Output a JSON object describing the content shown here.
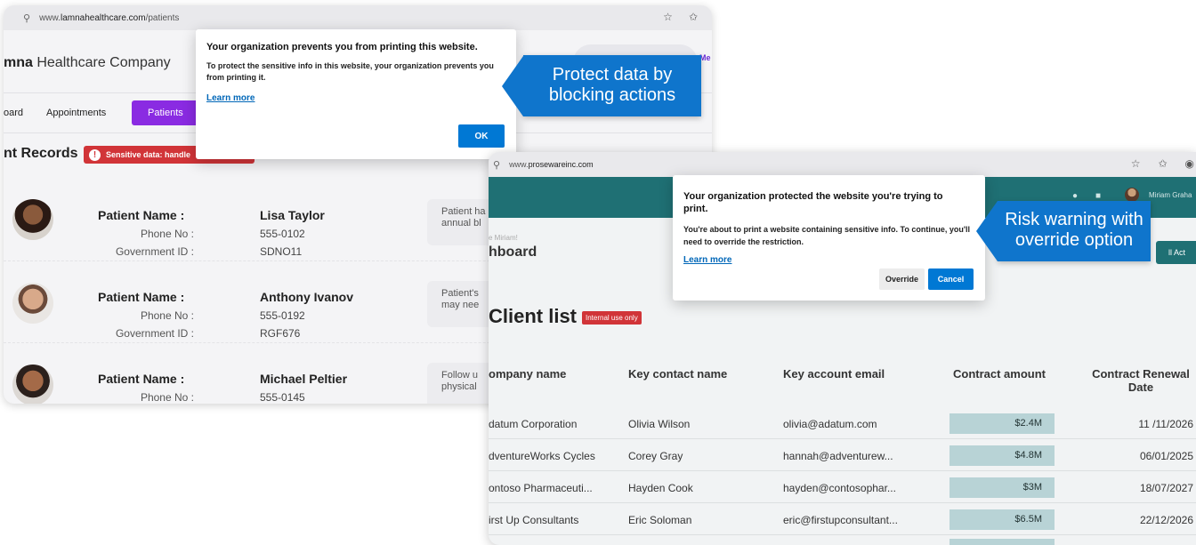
{
  "window1": {
    "url_prefix": "www.",
    "url_domain": "lamnahealthcare.com",
    "url_path": "/patients",
    "company_bold": "mna",
    "company_rest": " Healthcare Company",
    "header_user_fragment": "Me",
    "tabs": [
      {
        "label": "oard"
      },
      {
        "label": "Appointments"
      },
      {
        "label": "Patients"
      }
    ],
    "records_title": "nt Records",
    "sensitive_badge": "Sensitive data: handle",
    "field_labels": {
      "name": "Patient Name :",
      "phone": "Phone No :",
      "gov": "Government ID :"
    },
    "patients": [
      {
        "name": "Lisa Taylor",
        "phone": "555-0102",
        "gov_id": "SDNO11",
        "note_line1": "Patient ha",
        "note_line2": "annual bl"
      },
      {
        "name": "Anthony Ivanov",
        "phone": "555-0192",
        "gov_id": "RGF676",
        "note_line1": "Patient's",
        "note_line2": "may nee"
      },
      {
        "name": "Michael Peltier",
        "phone": "555-0145",
        "gov_id": "",
        "note_line1": "Follow u",
        "note_line2": "physical"
      }
    ],
    "dialog": {
      "title": "Your organization prevents you from printing this website.",
      "body": "To protect the sensitive info in this website, your organization prevents you from printing it.",
      "link": "Learn more",
      "ok": "OK"
    }
  },
  "callout1": {
    "line1": "Protect data by",
    "line2": "blocking actions"
  },
  "callout2": {
    "line1": "Risk warning with",
    "line2": "override option"
  },
  "window2": {
    "url_prefix": "www.",
    "url_domain": "prosewareinc.com",
    "user_name": "Miriam Graha",
    "welcome": "e Miriam!",
    "dashboard": "hboard",
    "all_activity": "ll Act",
    "client_title": "Client list",
    "internal_badge": "Internal use only",
    "columns": [
      "ompany name",
      "Key contact name",
      "Key account email",
      "Contract amount",
      "Contract Renewal Date"
    ],
    "rows": [
      {
        "company": "datum Corporation",
        "contact": "Olivia Wilson",
        "email": "olivia@adatum.com",
        "amount": "$2.4M",
        "date": "11 /11/2026"
      },
      {
        "company": "dventureWorks Cycles",
        "contact": "Corey Gray",
        "email": "hannah@adventurew...",
        "amount": "$4.8M",
        "date": "06/01/2025"
      },
      {
        "company": "ontoso Pharmaceuti...",
        "contact": "Hayden Cook",
        "email": "hayden@contosophar...",
        "amount": "$3M",
        "date": "18/07/2027"
      },
      {
        "company": "irst Up Consultants",
        "contact": "Eric Soloman",
        "email": "eric@firstupconsultant...",
        "amount": "$6.5M",
        "date": "22/12/2026"
      }
    ],
    "dialog": {
      "title": "Your organization protected the website you're trying to print.",
      "body": "You're about to print a website containing sensitive info. To continue, you'll need to override the restriction.",
      "link": "Learn more",
      "override": "Override",
      "cancel": "Cancel"
    }
  },
  "colors": {
    "accent_blue": "#0078d4",
    "callout_blue": "#0f75cc",
    "tab_purple": "#8a2be2",
    "teal_header": "#1f7074",
    "danger_red": "#d13438",
    "amount_fill": "#b8d3d6"
  },
  "icons": [
    "search-icon",
    "favorite-icon",
    "collections-icon",
    "alert-icon"
  ]
}
